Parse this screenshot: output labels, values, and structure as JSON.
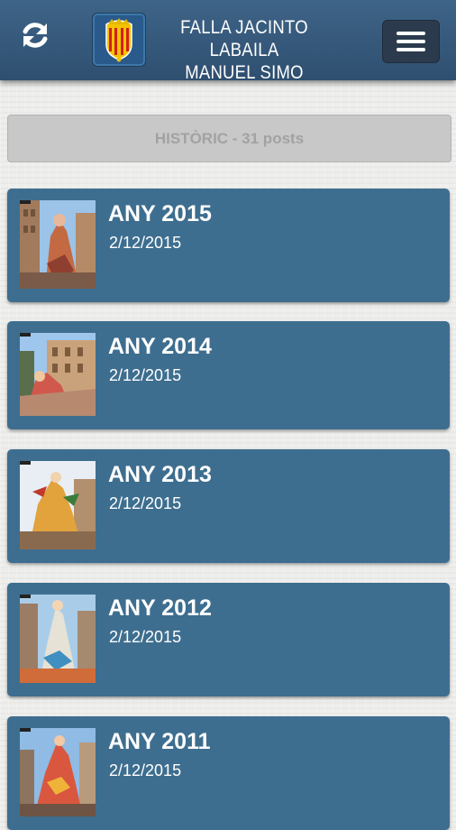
{
  "header": {
    "title_line1": "FALLA JACINTO LABAILA",
    "title_line2": "MANUEL SIMO",
    "refresh_icon": "refresh-icon",
    "menu_icon": "hamburger-menu-icon",
    "bar_color": "#35597c"
  },
  "section": {
    "count_label": "HISTÒRIC - 31 posts"
  },
  "posts": [
    {
      "title": "ANY 2015",
      "date": "2/12/2015"
    },
    {
      "title": "ANY 2014",
      "date": "2/12/2015"
    },
    {
      "title": "ANY 2013",
      "date": "2/12/2015"
    },
    {
      "title": "ANY 2012",
      "date": "2/12/2015"
    },
    {
      "title": "ANY 2011",
      "date": "2/12/2015"
    }
  ],
  "colors": {
    "card": "#3e6e8f",
    "count_bar": "#c8c8c8",
    "menu_button": "#2b3b4d"
  }
}
